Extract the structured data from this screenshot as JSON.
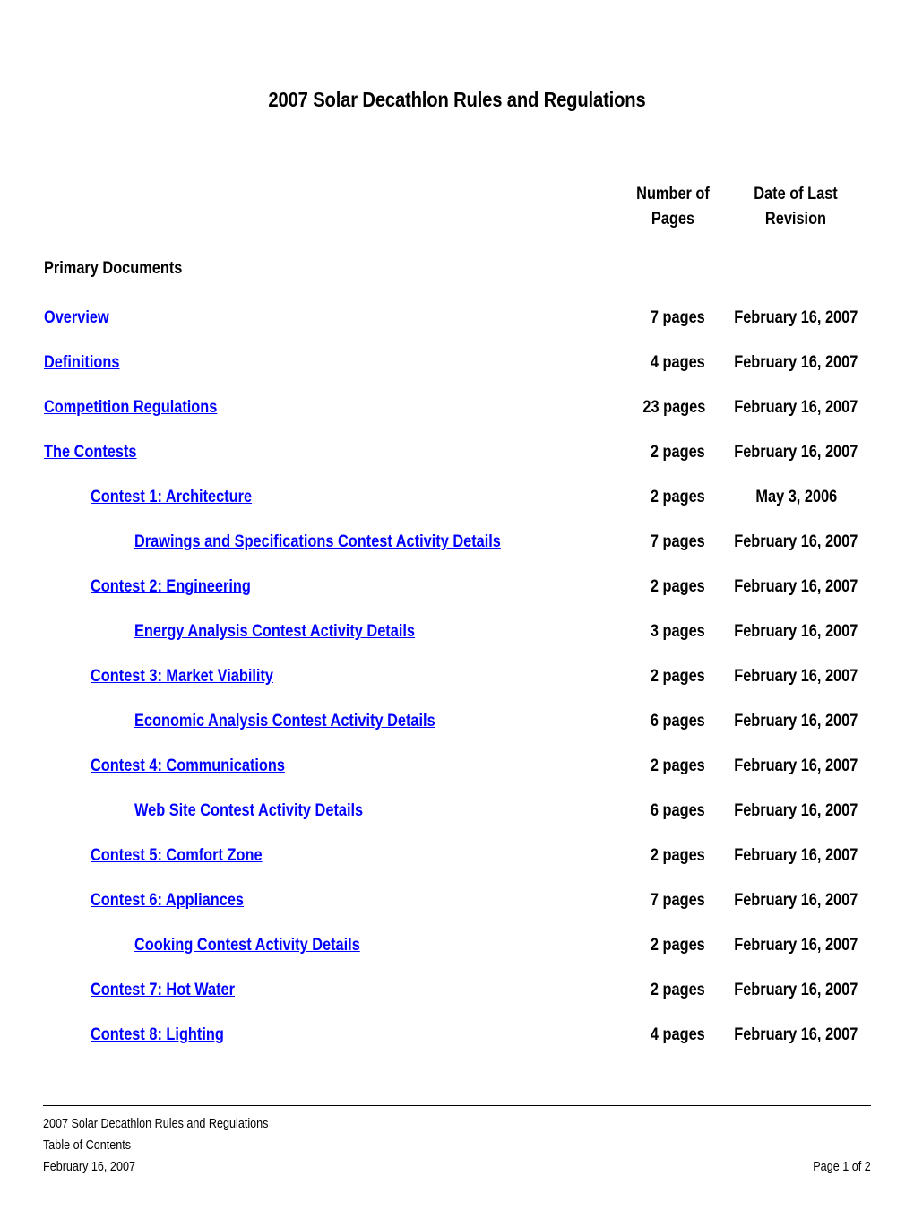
{
  "document": {
    "title": "2007 Solar Decathlon Rules and Regulations"
  },
  "columns": {
    "pages_header_line1": "Number of",
    "pages_header_line2": "Pages",
    "date_header_line1": "Date of Last",
    "date_header_line2": "Revision"
  },
  "section": {
    "heading": "Primary Documents"
  },
  "entries": [
    {
      "label": "Overview",
      "pages": "7 pages",
      "date": "February 16, 2007",
      "level": 0
    },
    {
      "label": "Definitions",
      "pages": "4 pages",
      "date": "February 16, 2007",
      "level": 0
    },
    {
      "label": "Competition Regulations",
      "pages": "23 pages",
      "date": "February 16, 2007",
      "level": 0
    },
    {
      "label": "The Contests",
      "pages": "2 pages",
      "date": "February 16, 2007",
      "level": 0
    },
    {
      "label": "Contest 1:  Architecture",
      "pages": "2 pages",
      "date": "May 3, 2006",
      "level": 1
    },
    {
      "label": "Drawings and Specifications Contest Activity Details",
      "pages": "7 pages",
      "date": "February 16, 2007",
      "level": 2
    },
    {
      "label": "Contest 2:  Engineering",
      "pages": "2 pages",
      "date": "February 16, 2007",
      "level": 1
    },
    {
      "label": "Energy Analysis Contest Activity Details",
      "pages": "3 pages",
      "date": "February 16, 2007",
      "level": 2
    },
    {
      "label": "Contest 3:  Market Viability",
      "pages": "2 pages",
      "date": "February 16, 2007",
      "level": 1
    },
    {
      "label": "Economic Analysis Contest Activity Details",
      "pages": "6 pages",
      "date": "February 16, 2007",
      "level": 2
    },
    {
      "label": "Contest 4:  Communications",
      "pages": "2 pages",
      "date": "February 16, 2007",
      "level": 1
    },
    {
      "label": "Web Site Contest Activity Details",
      "pages": "6 pages",
      "date": "February 16, 2007",
      "level": 2
    },
    {
      "label": "Contest 5:  Comfort Zone",
      "pages": "2 pages",
      "date": "February 16, 2007",
      "level": 1
    },
    {
      "label": "Contest 6:  Appliances",
      "pages": "7 pages",
      "date": "February 16, 2007",
      "level": 1
    },
    {
      "label": "Cooking Contest Activity Details",
      "pages": "2 pages",
      "date": "February 16, 2007",
      "level": 2
    },
    {
      "label": "Contest 7:  Hot Water",
      "pages": "2 pages",
      "date": "February 16, 2007",
      "level": 1
    },
    {
      "label": "Contest 8:  Lighting",
      "pages": "4 pages",
      "date": "February 16, 2007",
      "level": 1
    }
  ],
  "footer": {
    "line1": "2007 Solar Decathlon Rules and Regulations",
    "line2": "Table of Contents",
    "line3": "February 16, 2007",
    "page_number": "Page 1 of 2"
  },
  "colors": {
    "link": "#0000FF",
    "text": "#000000",
    "background": "#FFFFFF"
  }
}
